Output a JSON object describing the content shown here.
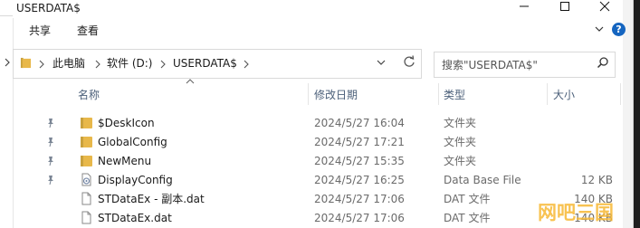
{
  "window": {
    "title": "USERDATA$"
  },
  "ribbon": {
    "tabs": [
      {
        "label": "共享"
      },
      {
        "label": "查看"
      }
    ]
  },
  "address": {
    "crumbs": [
      {
        "label": "此电脑"
      },
      {
        "label": "软件 (D:)"
      },
      {
        "label": "USERDATA$"
      }
    ]
  },
  "search": {
    "placeholder": "搜索\"USERDATA$\""
  },
  "columns": [
    {
      "label": "名称"
    },
    {
      "label": "修改日期"
    },
    {
      "label": "类型"
    },
    {
      "label": "大小"
    }
  ],
  "files": [
    {
      "name": "$DeskIcon",
      "date": "2024/5/27 16:04",
      "type": "文件夹",
      "size": "",
      "icon": "folder-icon",
      "pinned": true
    },
    {
      "name": "GlobalConfig",
      "date": "2024/5/27 17:21",
      "type": "文件夹",
      "size": "",
      "icon": "folder-icon",
      "pinned": true
    },
    {
      "name": "NewMenu",
      "date": "2024/5/27 15:35",
      "type": "文件夹",
      "size": "",
      "icon": "folder-icon",
      "pinned": true
    },
    {
      "name": "DisplayConfig",
      "date": "2024/5/27 16:25",
      "type": "Data Base File",
      "size": "12 KB",
      "icon": "database-file-icon",
      "pinned": true
    },
    {
      "name": "STDataEx - 副本.dat",
      "date": "2024/5/27 17:06",
      "type": "DAT 文件",
      "size": "140 KB",
      "icon": "file-icon",
      "pinned": false
    },
    {
      "name": "STDataEx.dat",
      "date": "2024/5/27 17:06",
      "type": "DAT 文件",
      "size": "140 KB",
      "icon": "file-icon",
      "pinned": false
    }
  ],
  "colors": {
    "folder": "#e8b84a",
    "header_text": "#4c607a",
    "help_blue": "#1565c0"
  }
}
